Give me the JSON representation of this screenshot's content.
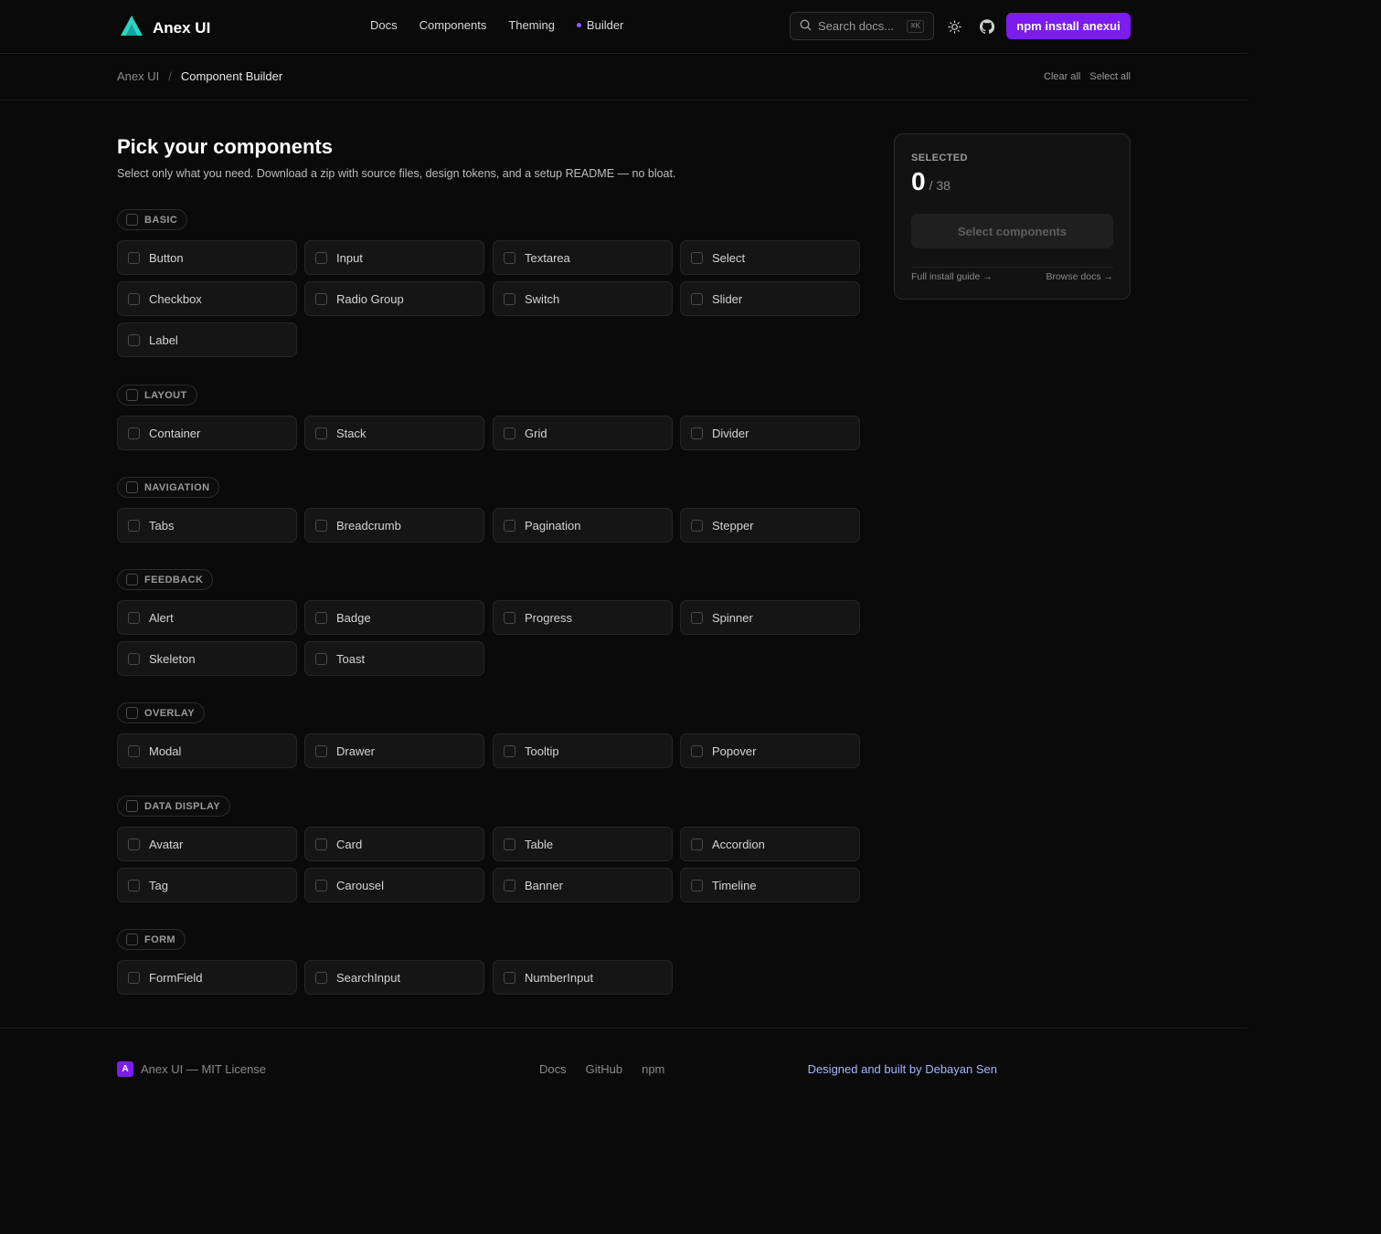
{
  "header": {
    "brand": "Anex UI",
    "nav": [
      "Docs",
      "Components",
      "Theming",
      "Builder"
    ],
    "active_nav": "Builder",
    "search_placeholder": "Search docs...",
    "search_shortcut": "⌘K",
    "install_cta": "npm install anexui",
    "icons": {
      "logo": "anex-logo-icon",
      "theme": "sun-icon",
      "github": "github-icon",
      "search": "search-icon"
    },
    "accent": "#7c1cf0"
  },
  "breadcrumb": {
    "root": "Anex UI",
    "separator": "/",
    "current": "Component Builder",
    "clear_all": "Clear all",
    "select_all": "Select all"
  },
  "main": {
    "title": "Pick your components",
    "subtitle": "Select only what you need. Download a zip with source files, design tokens, and a setup README — no bloat.",
    "sections": [
      {
        "label": "BASIC",
        "items": [
          "Button",
          "Input",
          "Textarea",
          "Select",
          "Checkbox",
          "Radio Group",
          "Switch",
          "Slider",
          "Label"
        ]
      },
      {
        "label": "LAYOUT",
        "items": [
          "Container",
          "Stack",
          "Grid",
          "Divider"
        ]
      },
      {
        "label": "NAVIGATION",
        "items": [
          "Tabs",
          "Breadcrumb",
          "Pagination",
          "Stepper"
        ]
      },
      {
        "label": "FEEDBACK",
        "items": [
          "Alert",
          "Badge",
          "Progress",
          "Spinner",
          "Skeleton",
          "Toast"
        ]
      },
      {
        "label": "OVERLAY",
        "items": [
          "Modal",
          "Drawer",
          "Tooltip",
          "Popover"
        ]
      },
      {
        "label": "DATA DISPLAY",
        "items": [
          "Avatar",
          "Card",
          "Table",
          "Accordion",
          "Tag",
          "Carousel",
          "Banner",
          "Timeline"
        ]
      },
      {
        "label": "FORM",
        "items": [
          "FormField",
          "SearchInput",
          "NumberInput"
        ]
      }
    ]
  },
  "panel": {
    "label": "SELECTED",
    "count": "0",
    "total": "/ 38",
    "button": "Select components",
    "link_install": "Full install guide →",
    "link_docs": "Browse docs →"
  },
  "footer": {
    "logo_letter": "A",
    "brand": "Anex UI — MIT License",
    "links": [
      "Docs",
      "GitHub",
      "npm"
    ],
    "credit": "Designed and built by Debayan Sen"
  }
}
